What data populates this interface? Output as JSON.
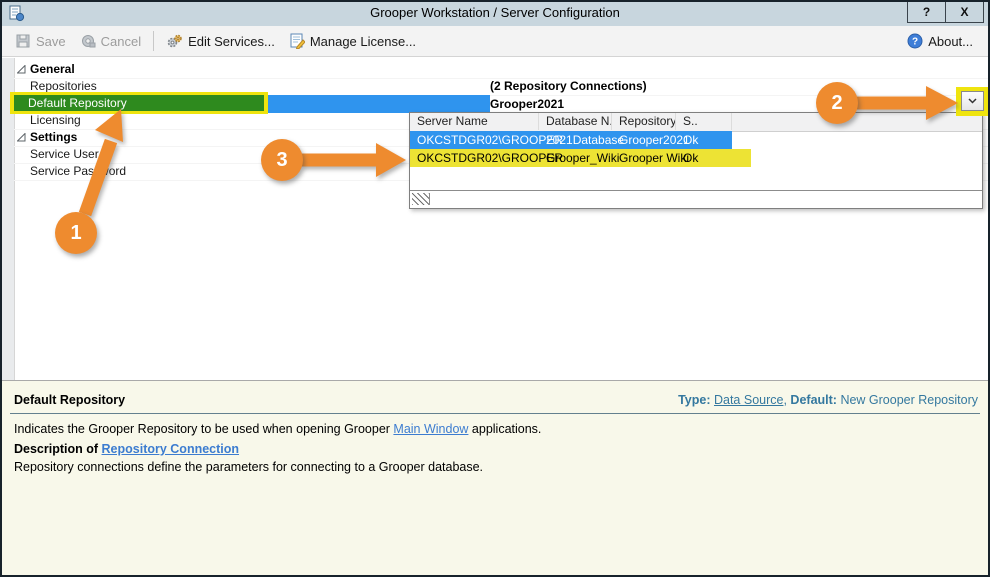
{
  "window": {
    "title": "Grooper Workstation / Server Configuration",
    "help": "?",
    "close": "X"
  },
  "toolbar": {
    "save": "Save",
    "cancel": "Cancel",
    "edit_services": "Edit Services...",
    "manage_license": "Manage License...",
    "about": "About..."
  },
  "grid": {
    "categories": [
      {
        "label": "General",
        "items": [
          {
            "label": "Repositories",
            "value": "(2 Repository Connections)"
          },
          {
            "label": "Default Repository",
            "value": "Grooper2021"
          },
          {
            "label": "Licensing",
            "value": ""
          }
        ]
      },
      {
        "label": "Settings",
        "items": [
          {
            "label": "Service User",
            "value": ""
          },
          {
            "label": "Service Password",
            "value": ""
          }
        ]
      }
    ]
  },
  "dropdown": {
    "columns": [
      "Server Name",
      "Database N...",
      "Repository ...",
      "S.."
    ],
    "rows": [
      [
        "OKCSTDGR02\\GROOPER",
        "2021Database",
        "Grooper2021",
        "Ok"
      ],
      [
        "OKCSTDGR02\\GROOPER",
        "Grooper_Wiki",
        "Grooper Wiki",
        "Ok"
      ]
    ]
  },
  "callouts": [
    "1",
    "2",
    "3"
  ],
  "panel": {
    "title": "Default Repository",
    "type_label": "Type:",
    "type_value": "Data Source",
    "comma": ", ",
    "default_label": "Default:",
    "default_value": "New Grooper Repository",
    "line1_prefix": "Indicates the Grooper Repository to be used when opening Grooper ",
    "line1_link": "Main Window",
    "line1_suffix": " applications.",
    "line2_prefix": "Description of ",
    "line2_link": "Repository Connection",
    "line3": "Repository connections define the parameters for connecting to a Grooper database."
  },
  "colors": {
    "callout_orange": "#EE8B2F",
    "marker_yellow": "#EFE40E",
    "selection_blue": "#2F94EE",
    "marker_green_overlap": "#2E8A1E",
    "titlebar": "#C8D6DE",
    "panel_bg": "#F8F8EA",
    "meta_teal": "#34789F",
    "link_blue": "#3C7CD0"
  }
}
